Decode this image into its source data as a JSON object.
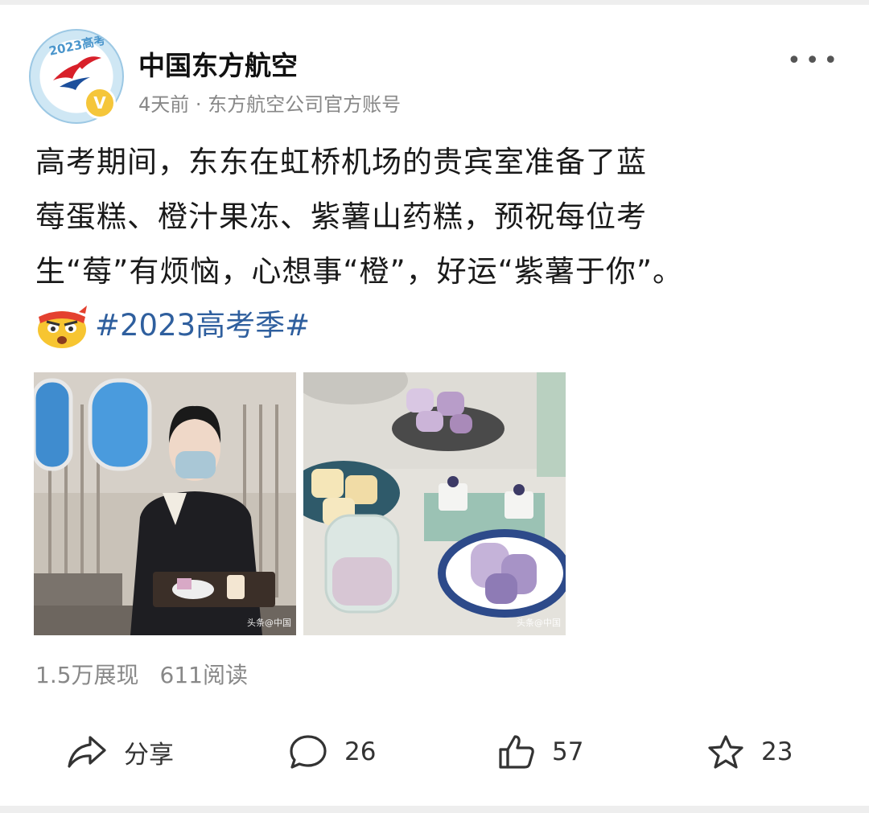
{
  "account": {
    "name": "中国东方航空",
    "meta": "4天前 · 东方航空公司官方账号",
    "avatar_text": "2023高考季",
    "verified_mark": "V"
  },
  "post": {
    "lines": [
      "高考期间，东东在虹桥机场的贵宾室准备了蓝",
      "莓蛋糕、橙汁果冻、紫薯山药糕，预祝每位考",
      "生“莓”有烦恼，心想事“橙”，好运“紫薯于你”。"
    ],
    "hashtag": "#2023高考季#"
  },
  "images": [
    {
      "watermark": "头条@中国"
    },
    {
      "watermark": "头条@中国"
    }
  ],
  "stats": {
    "impressions": "1.5万展现",
    "reads": "611阅读"
  },
  "actions": {
    "share": "分享",
    "comments": "26",
    "likes": "57",
    "favorites": "23"
  },
  "colors": {
    "hashtag": "#2f5f9e",
    "text": "#1a1a1a",
    "muted": "#888888"
  }
}
